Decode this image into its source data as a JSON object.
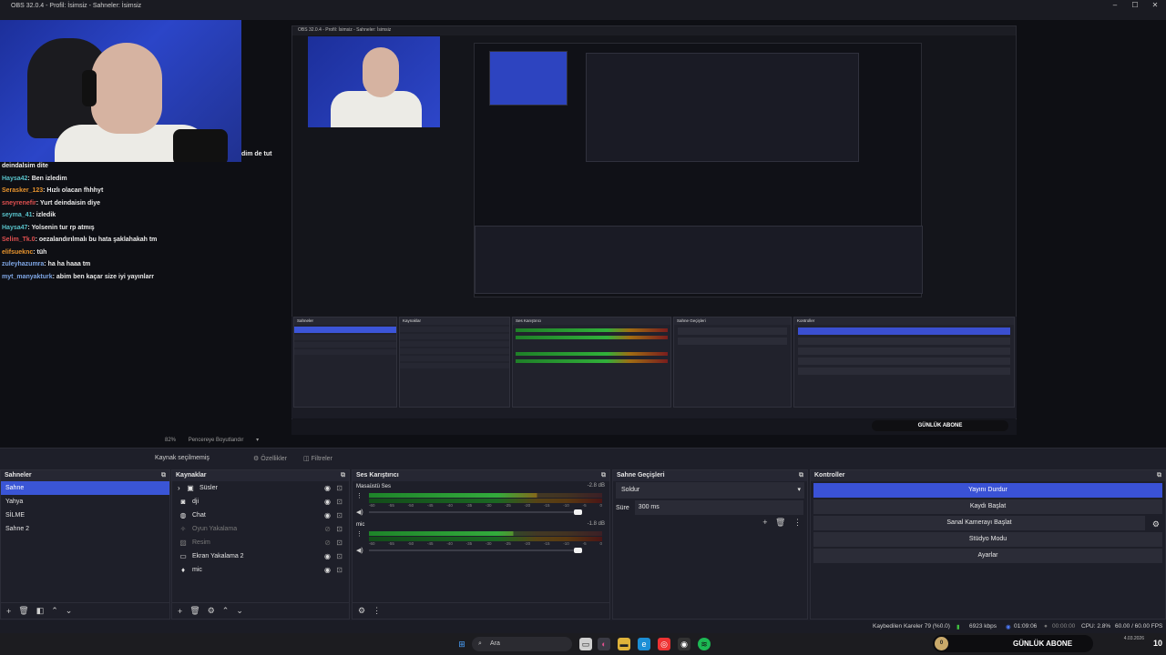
{
  "window": {
    "title": "OBS 32.0.4 - Profil: İsimsiz - Sahneler: İsimsiz",
    "controls": [
      "–",
      "☐",
      "✕"
    ]
  },
  "overlay": {
    "webcam_caption": "dim de tut",
    "chat": [
      {
        "user": "deindalsim dite",
        "msg": "",
        "color": "white"
      },
      {
        "user": "Haysa42",
        "msg": ": Ben izledim",
        "color": "teal"
      },
      {
        "user": "Serasker_123",
        "msg": ": Hızlı olacan fhhhyt",
        "color": "orange"
      },
      {
        "user": "sneyrenefir",
        "msg": ": Yurt deindaisin diye",
        "color": "red"
      },
      {
        "user": "seyma_41",
        "msg": ": izledik",
        "color": "teal"
      },
      {
        "user": "Haysa47",
        "msg": ": Yolsenin tur rp atmış",
        "color": "teal"
      },
      {
        "user": "Selim_Tk.0",
        "msg": ": oezalandırılmalı bu hata şaklahakah tm",
        "color": "red"
      },
      {
        "user": "elifsueknc",
        "msg": ": tüh",
        "color": "orange"
      },
      {
        "user": "zuleyhazumra",
        "msg": ": ha ha haaa tm",
        "color": "blue"
      },
      {
        "user": "myt_manyakturk",
        "msg": ": abim ben kaçar size iyi yayınlarr",
        "color": "blue"
      }
    ],
    "badge": "GÜNLÜK ABONE"
  },
  "preview_bar": {
    "zoom": "82%",
    "fit": "Pencereye Boyutlandır"
  },
  "source_toolbar": {
    "label": "Kaynak seçilmemiş",
    "properties": "Özellikler",
    "filters": "Filtreler"
  },
  "scenes": {
    "title": "Sahneler",
    "items": [
      "Sahne",
      "Yahya",
      "SİLME",
      "Sahne 2"
    ],
    "active_index": 0
  },
  "sources": {
    "title": "Kaynaklar",
    "items": [
      {
        "name": "Süsler",
        "icon": "folder-icon",
        "visible": true,
        "dim": false,
        "group": true
      },
      {
        "name": "dji",
        "icon": "camera-icon",
        "visible": true,
        "dim": false,
        "group": false
      },
      {
        "name": "Chat",
        "icon": "browser-icon",
        "visible": true,
        "dim": false,
        "group": false
      },
      {
        "name": "Oyun Yakalama",
        "icon": "gamepad-icon",
        "visible": false,
        "dim": true,
        "group": false
      },
      {
        "name": "Resim",
        "icon": "image-icon",
        "visible": false,
        "dim": true,
        "group": false
      },
      {
        "name": "Ekran Yakalama 2",
        "icon": "monitor-icon",
        "visible": true,
        "dim": false,
        "group": false
      },
      {
        "name": "mic",
        "icon": "mic-icon",
        "visible": true,
        "dim": false,
        "group": false
      }
    ]
  },
  "mixer": {
    "title": "Ses Karıştırıcı",
    "channels": [
      {
        "name": "Masaüstü Ses",
        "db": "-2.8 dB",
        "level": 0.72
      },
      {
        "name": "mic",
        "db": "-1.8 dB",
        "level": 0.62
      }
    ],
    "ticks": [
      "-60",
      "-55",
      "-50",
      "-45",
      "-40",
      "-35",
      "-30",
      "-25",
      "-20",
      "-15",
      "-10",
      "-5",
      "0"
    ]
  },
  "transitions": {
    "title": "Sahne Geçişleri",
    "selected": "Soldur",
    "duration_label": "Süre",
    "duration_value": "300 ms"
  },
  "controls": {
    "title": "Kontroller",
    "buttons": [
      "Yayını Durdur",
      "Kaydı Başlat",
      "Sanal Kamerayı Başlat",
      "Stüdyo Modu",
      "Ayarlar"
    ]
  },
  "status": {
    "dropped": "Kaybedilen Kareler 79 (%0.0)",
    "bitrate": "6923 kbps",
    "stream_time": "01:09:06",
    "rec_time": "00:00:00",
    "cpu": "CPU: 2.8%",
    "fps": "60.00 / 60.00 FPS"
  },
  "taskbar": {
    "search": "Ara",
    "badge": "GÜNLÜK ABONE",
    "notif": "10",
    "date": "4.03.2026"
  }
}
